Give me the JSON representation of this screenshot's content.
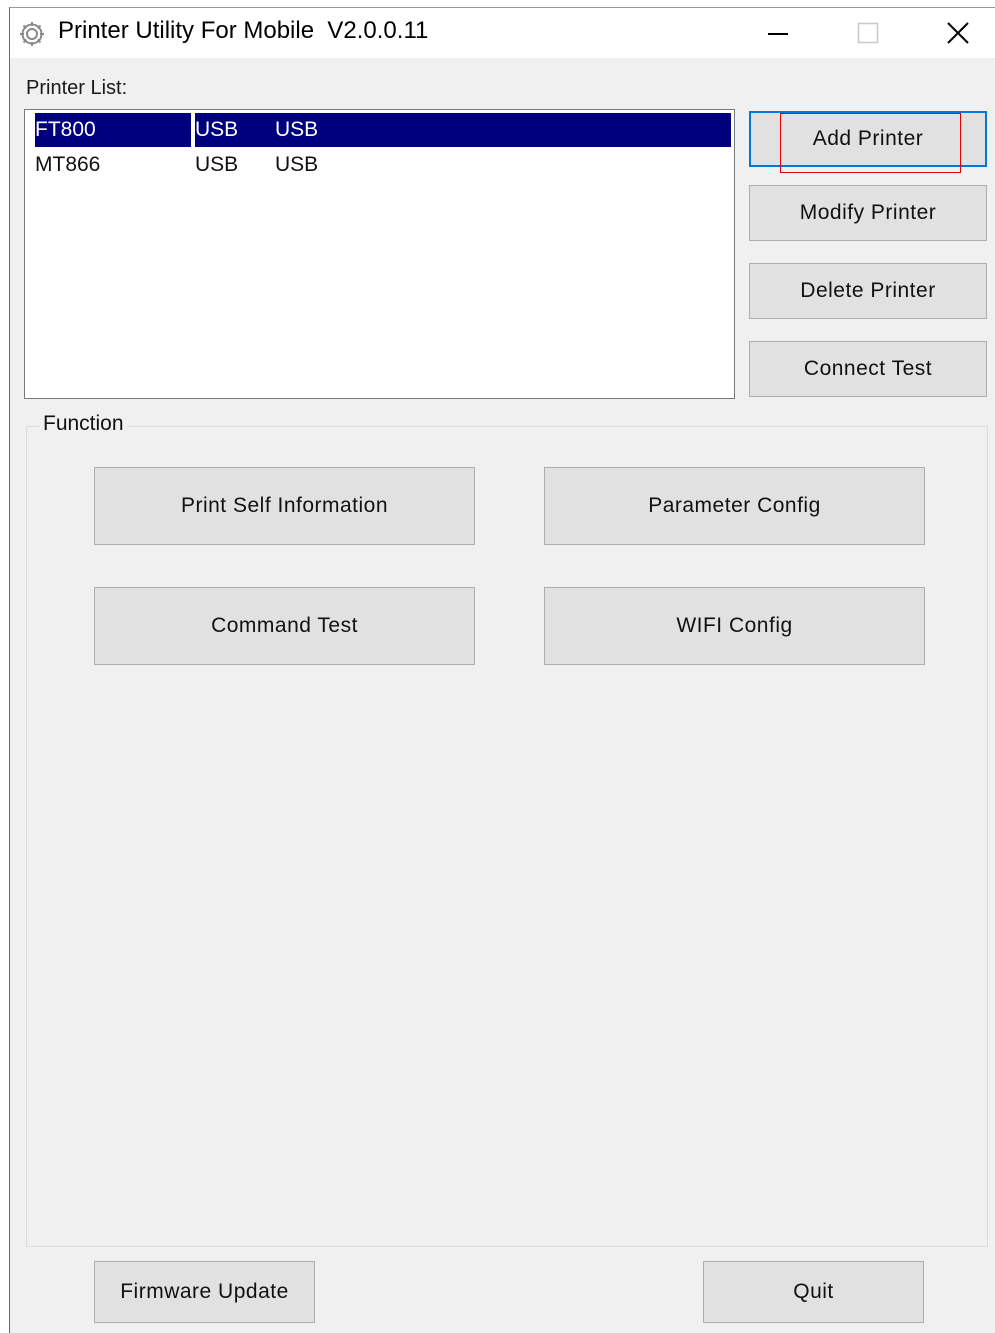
{
  "window": {
    "title": "Printer Utility For Mobile  V2.0.0.11",
    "icon": "gear-icon",
    "controls": [
      "minimize-icon",
      "maximize-icon",
      "close-icon"
    ]
  },
  "printer_list": {
    "label": "Printer List:",
    "rows": [
      {
        "name": "FT800",
        "col2": "USB",
        "col3": "USB",
        "selected": true
      },
      {
        "name": "MT866",
        "col2": "USB",
        "col3": "USB",
        "selected": false
      }
    ],
    "selection_color": "#00007f"
  },
  "side_buttons": {
    "add": "Add Printer",
    "modify": "Modify Printer",
    "delete": "Delete Printer",
    "connect": "Connect Test"
  },
  "function_group": {
    "title": "Function",
    "print_self": "Print Self Information",
    "parameter_config": "Parameter Config",
    "command_test": "Command Test",
    "wifi_config": "WIFI Config"
  },
  "footer": {
    "firmware": "Firmware Update",
    "quit": "Quit"
  },
  "colors": {
    "highlight_box": "#e00000",
    "focus_border": "#0078d7"
  }
}
